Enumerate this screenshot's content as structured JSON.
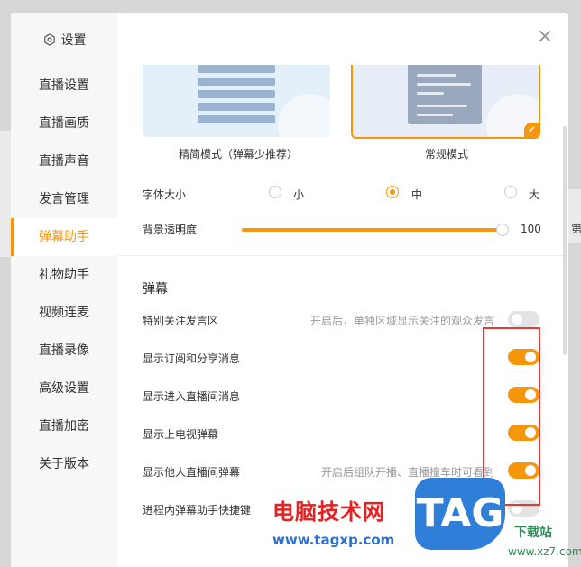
{
  "sidebar": {
    "title": "设置",
    "items": [
      {
        "label": "直播设置",
        "active": false
      },
      {
        "label": "直播画质",
        "active": false
      },
      {
        "label": "直播声音",
        "active": false
      },
      {
        "label": "发言管理",
        "active": false
      },
      {
        "label": "弹幕助手",
        "active": true
      },
      {
        "label": "礼物助手",
        "active": false
      },
      {
        "label": "视频连麦",
        "active": false
      },
      {
        "label": "直播录像",
        "active": false
      },
      {
        "label": "高级设置",
        "active": false
      },
      {
        "label": "直播加密",
        "active": false
      },
      {
        "label": "关于版本",
        "active": false
      }
    ]
  },
  "modes": {
    "simple_label": "精简模式（弹幕少推荐）",
    "normal_label": "常规模式",
    "selected": "normal"
  },
  "font_size": {
    "label": "字体大小",
    "options": [
      "小",
      "中",
      "大"
    ],
    "selected": "中"
  },
  "opacity": {
    "label": "背景透明度",
    "value": 100,
    "max": 100
  },
  "danmaku": {
    "section_title": "弹幕",
    "options": [
      {
        "label": "特别关注发言区",
        "hint": "开启后，单独区域显示关注的观众发言",
        "on": false
      },
      {
        "label": "显示订阅和分享消息",
        "hint": "",
        "on": true
      },
      {
        "label": "显示进入直播间消息",
        "hint": "",
        "on": true
      },
      {
        "label": "显示上电视弹幕",
        "hint": "",
        "on": true
      },
      {
        "label": "显示他人直播间弹幕",
        "hint": "开启后组队开播、直播撞车时可看到",
        "on": true
      },
      {
        "label": "进程内弹幕助手快捷键",
        "hint": "",
        "on": false
      }
    ]
  },
  "watermark": {
    "site_cn": "电脑技术网",
    "site_url": "www.tagxp.com",
    "logo": "TAG",
    "download_cn": "下载站",
    "download_url": "www.xz7.com"
  },
  "peek_text": "第",
  "colors": {
    "accent": "#f6960b",
    "highlight_box": "#e53935"
  }
}
